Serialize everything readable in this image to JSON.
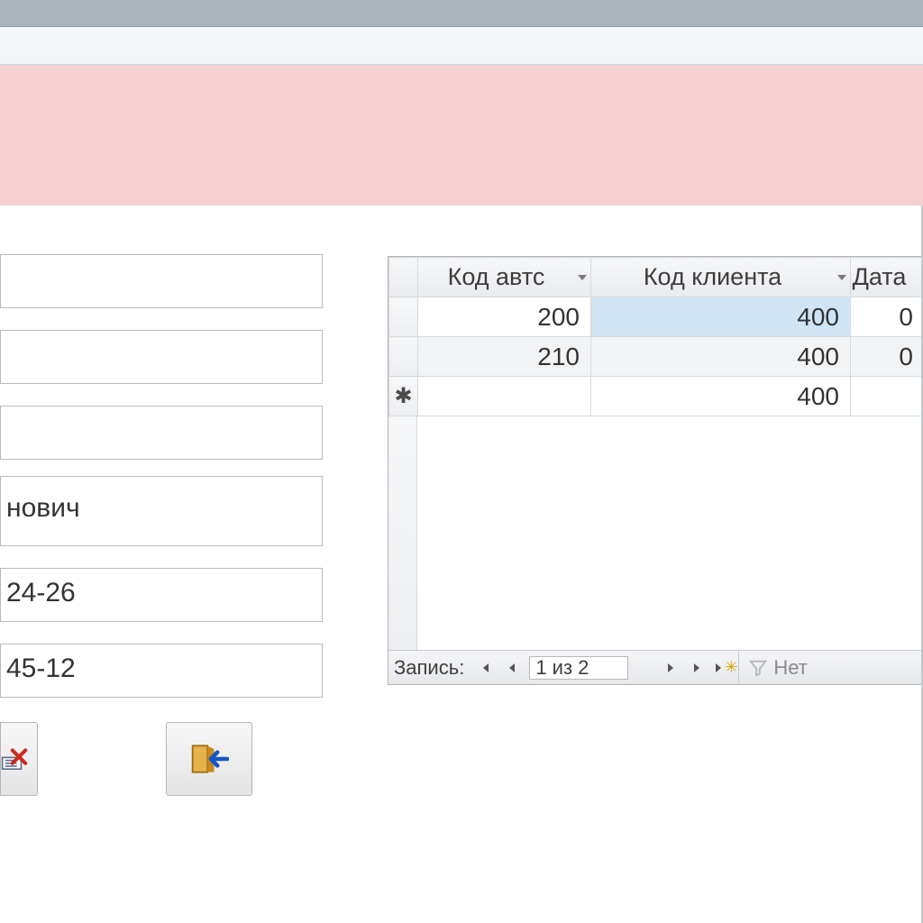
{
  "form": {
    "fields": {
      "f1": "",
      "f2": "",
      "f3": "",
      "f4": "нович",
      "f5": "24-26",
      "f6": "45-12"
    }
  },
  "subform": {
    "columns": {
      "c1": "Код автс",
      "c2": "Код клиента",
      "c3": "Дата"
    },
    "rows": [
      {
        "c1": "200",
        "c2": "400",
        "c3": "0",
        "c2_selected": true
      },
      {
        "c1": "210",
        "c2": "400",
        "c3": "0"
      }
    ],
    "new_row": {
      "c2": "400"
    }
  },
  "recnav": {
    "label": "Запись:",
    "position": "1 из 2",
    "filter_label": "Нет"
  }
}
